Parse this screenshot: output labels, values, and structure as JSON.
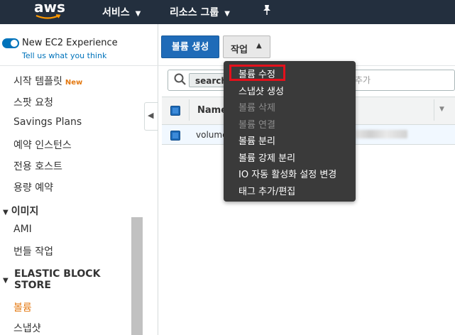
{
  "topnav": {
    "logo_text": "aws",
    "services_label": "서비스",
    "resource_groups_label": "리소스 그룹"
  },
  "sidebar": {
    "new_ec2_toggle_label": "New EC2 Experience",
    "tell_us_link": "Tell us what you think",
    "items": [
      {
        "label": "시작 템플릿",
        "badge": "New"
      },
      {
        "label": "스팟 요청"
      },
      {
        "label": "Savings Plans"
      },
      {
        "label": "예약 인스턴스"
      },
      {
        "label": "전용 호스트"
      },
      {
        "label": "용량 예약"
      }
    ],
    "images_section": "이미지",
    "images_items": [
      {
        "label": "AMI"
      },
      {
        "label": "번들 작업"
      }
    ],
    "ebs_section_line1": "ELASTIC BLOCK",
    "ebs_section_line2": "STORE",
    "ebs_items": [
      {
        "label": "볼륨",
        "active": true
      },
      {
        "label": "스냅샷"
      }
    ]
  },
  "toolbar": {
    "create_volume_label": "볼륨 생성",
    "actions_label": "작업"
  },
  "search": {
    "chip_label": "search",
    "placeholder_suffix": "추가"
  },
  "table": {
    "columns": [
      "Name"
    ],
    "rows": [
      {
        "name": "volume"
      }
    ]
  },
  "actions_menu": {
    "items": [
      {
        "label": "볼륨 수정",
        "enabled": true,
        "highlighted": true
      },
      {
        "label": "스냅샷 생성",
        "enabled": true
      },
      {
        "label": "볼륨 삭제",
        "enabled": false
      },
      {
        "label": "볼륨 연결",
        "enabled": false
      },
      {
        "label": "볼륨 분리",
        "enabled": true
      },
      {
        "label": "볼륨 강제 분리",
        "enabled": true
      },
      {
        "label": "IO 자동 활성화 설정 변경",
        "enabled": true
      },
      {
        "label": "태그 추가/편집",
        "enabled": true
      }
    ]
  },
  "colors": {
    "nav_bg": "#232f3e",
    "primary": "#1f6bb8",
    "accent_orange": "#e47911",
    "menu_bg": "#3a3a3a",
    "highlight_red": "#e5101b"
  }
}
